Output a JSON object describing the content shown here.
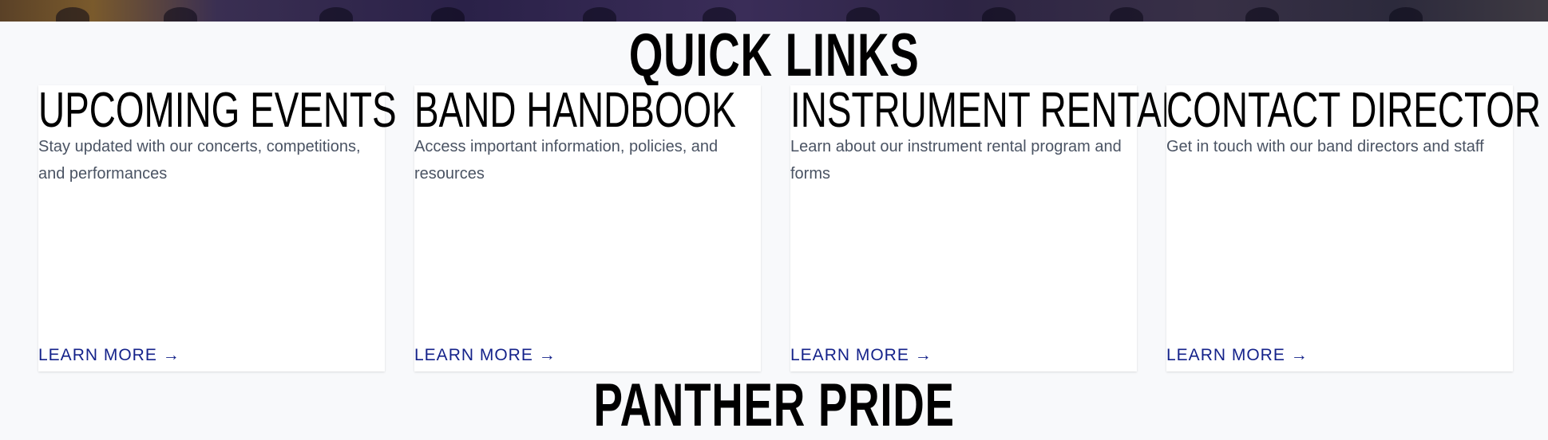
{
  "quick_links": {
    "title": "QUICK LINKS",
    "cards": [
      {
        "title": "UPCOMING EVENTS",
        "description": "Stay updated with our concerts, competitions, and performances",
        "link_label": "LEARN MORE →"
      },
      {
        "title": "BAND HANDBOOK",
        "description": "Access important information, policies, and resources",
        "link_label": "LEARN MORE →"
      },
      {
        "title": "INSTRUMENT RENTAL",
        "description": "Learn about our instrument rental program and forms",
        "link_label": "LEARN MORE →"
      },
      {
        "title": "CONTACT DIRECTOR",
        "description": "Get in touch with our band directors and staff",
        "link_label": "LEARN MORE →"
      }
    ]
  },
  "next_section": {
    "title": "PANTHER PRIDE"
  },
  "colors": {
    "background": "#f8f9fb",
    "card_background": "#ffffff",
    "link": "#14228a",
    "description": "#4a5363",
    "heading": "#000000"
  }
}
